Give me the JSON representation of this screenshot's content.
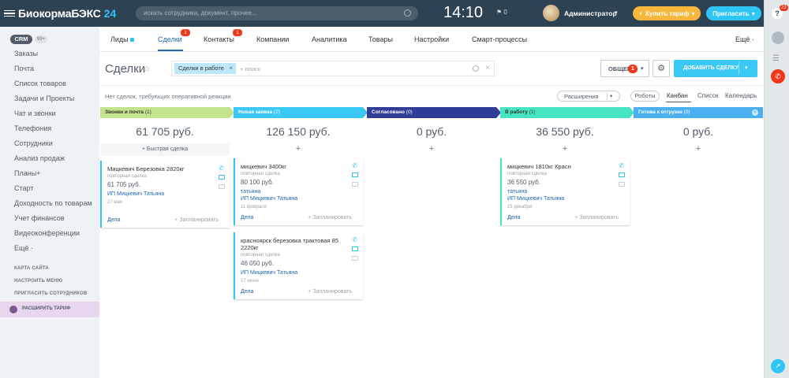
{
  "topbar": {
    "brand": "БиокормаБЭКС",
    "brand_suffix": "24",
    "search_placeholder": "искать сотрудника, документ, прочее...",
    "time": "14:10",
    "flag_count": "0",
    "user": "Администратор",
    "buy_label": "Купить тариф",
    "invite_label": "Пригласить"
  },
  "rail": {
    "help_badge": "22"
  },
  "sidebar": {
    "crm": "CRM",
    "crm_count": "99+",
    "items": [
      "Заказы",
      "Почта",
      "Список товаров",
      "Задачи и Проекты",
      "Чат и звонки",
      "Телефония",
      "Сотрудники",
      "Анализ продаж",
      "Планы+",
      "Старт",
      "Доходность по товарам",
      "Учет финансов",
      "Видеоконференции",
      "Ещё ·"
    ],
    "site_map": "КАРТА САЙТА",
    "setup_menu": "НАСТРОИТЬ МЕНЮ",
    "invite_staff": "ПРИГЛАСИТЬ СОТРУДНИКОВ",
    "upgrade": "РАСШИРИТЬ ТАРИФ"
  },
  "tabs": {
    "leads": "Лиды",
    "deals": "Сделки",
    "deals_badge": "1",
    "contacts": "Контакты",
    "contacts_badge": "1",
    "companies": "Компании",
    "analytics": "Аналитика",
    "goods": "Товары",
    "settings": "Настройки",
    "smart": "Смарт-процессы",
    "more": "Ещё ·"
  },
  "toolbar": {
    "title": "Сделки",
    "filter_chip": "Сделки в работе",
    "filter_placeholder": "+ поиск",
    "general_label": "ОБЩЕЕ",
    "general_badge": "1",
    "add_label": "ДОБАВИТЬ СДЕЛКУ",
    "notice": "Нет сделок, требующих оперативной реакции",
    "extensions": "Расширения",
    "robots": "Роботы",
    "view_kanban": "Канбан",
    "view_list": "Список",
    "view_calendar": "Календарь"
  },
  "colors": {
    "calls": "#c3e38c",
    "new": "#3bc8f5",
    "agreed": "#2f3d97",
    "in_work": "#47e4c2",
    "ready": "#4ab0ef"
  },
  "columns": [
    {
      "name": "Звонки и почта",
      "count": "(1)",
      "sum": "61 705 руб.",
      "plus": "",
      "quick": "+ Быстрая сделка",
      "cards": [
        {
          "title": "Мицкевич Березовка 2820кг",
          "sub": "повторная сделка",
          "sum": "61 705 руб.",
          "link": "ИП Мицкевич Татьяна",
          "date": "27 мая",
          "deals": "Дела",
          "plan": "+ Запланировать"
        }
      ]
    },
    {
      "name": "Новая заявка",
      "count": "(2)",
      "sum": "126 150 руб.",
      "plus": "+",
      "cards": [
        {
          "title": "мицкевич 3400кг",
          "sub": "повторная сделка",
          "sum": "80 100 руб.",
          "link": "татьяна",
          "link2": "ИП Мицкевич Татьяна",
          "date": "11 февраля",
          "deals": "Дела",
          "plan": "+ Запланировать"
        },
        {
          "title": "красноярск березовка трактовая 85 2220кг",
          "sub": "повторная сделка",
          "sum": "46 050 руб.",
          "link": "ИП Мицкевич Татьяна",
          "date": "17 июня",
          "deals": "Дела",
          "plan": "+ Запланировать"
        }
      ]
    },
    {
      "name": "Согласовано",
      "count": "(0)",
      "sum": "0 руб.",
      "plus": "+",
      "cards": []
    },
    {
      "name": "В работу",
      "count": "(1)",
      "sum": "36 550 руб.",
      "plus": "+",
      "cards": [
        {
          "title": "мицкевич 1810кг Красн",
          "sub": "повторная сделка",
          "sum": "36 550 руб.",
          "link": "татьяна",
          "link2": "ИП Мицкевич Татьяна",
          "date": "15 декабря",
          "deals": "Дела",
          "plan": "+ Запланировать"
        }
      ]
    },
    {
      "name": "Готова к отгрузке",
      "count": "(0)",
      "sum": "0 руб.",
      "plus": "+",
      "cards": []
    }
  ]
}
